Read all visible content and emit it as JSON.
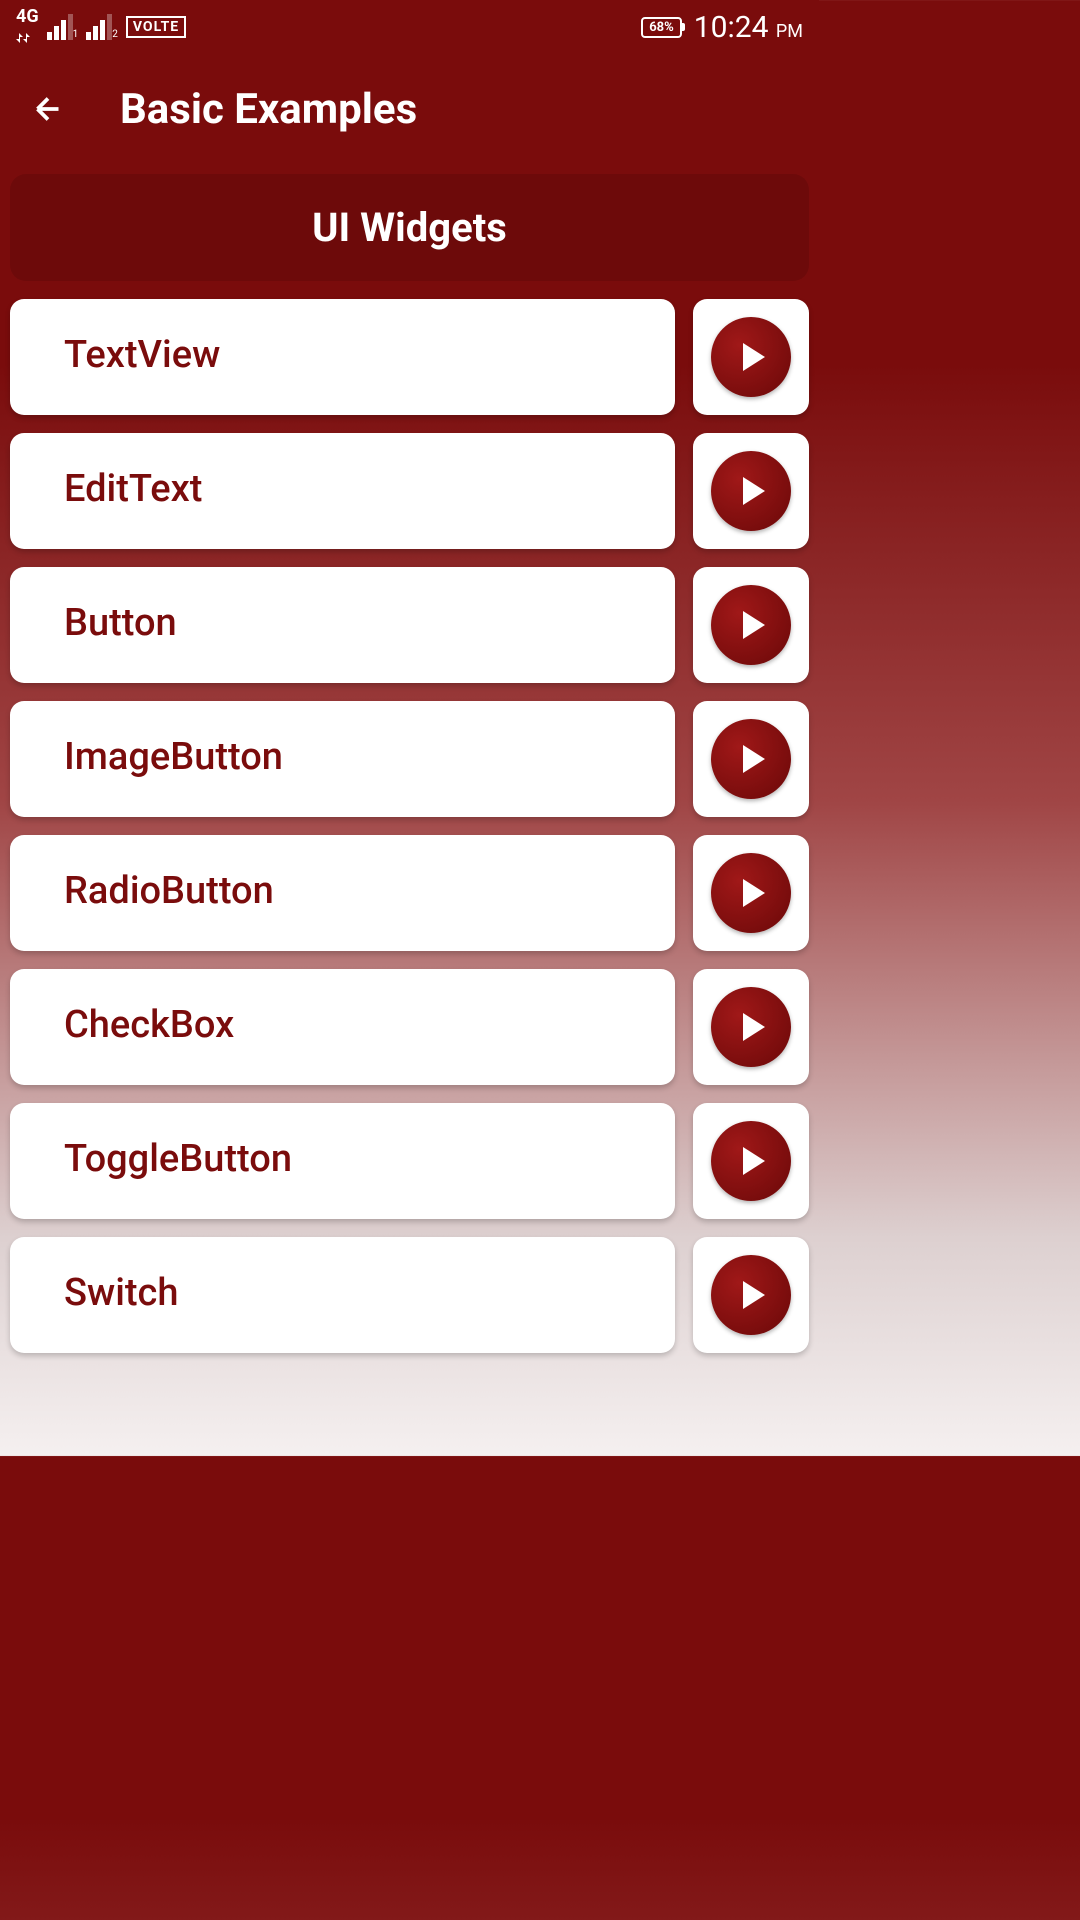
{
  "status_bar": {
    "network_type": "4G",
    "signal1_sub": "1",
    "signal2_sub": "2",
    "volte": "VOLTE",
    "battery": "68%",
    "time": "10:24",
    "time_suffix": "PM"
  },
  "header": {
    "title": "Basic Examples"
  },
  "section": {
    "title": "UI Widgets"
  },
  "items": [
    {
      "label": "TextView"
    },
    {
      "label": "EditText"
    },
    {
      "label": "Button"
    },
    {
      "label": "ImageButton"
    },
    {
      "label": "RadioButton"
    },
    {
      "label": "CheckBox"
    },
    {
      "label": "ToggleButton"
    },
    {
      "label": "Switch"
    }
  ]
}
